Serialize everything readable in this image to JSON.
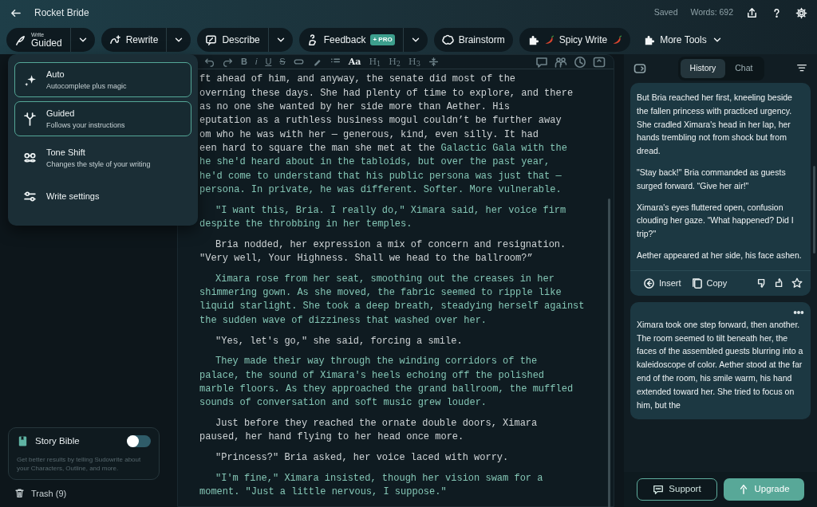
{
  "header": {
    "title": "Rocket Bride",
    "status": "Saved",
    "word_count": "Words: 692"
  },
  "tools": [
    {
      "kind": "write",
      "caption": "Write",
      "label": "Guided",
      "split": true
    },
    {
      "kind": "rewrite",
      "label": "Rewrite",
      "split": true
    },
    {
      "kind": "describe",
      "label": "Describe",
      "split": true
    },
    {
      "kind": "feedback",
      "label": "Feedback",
      "badge": "+ PRO",
      "split": true
    },
    {
      "kind": "brainstorm",
      "label": "Brainstorm",
      "split": false
    },
    {
      "kind": "plugin",
      "label": "Spicy Write",
      "chilis": true,
      "split": false
    },
    {
      "kind": "menu",
      "label": "More Tools"
    }
  ],
  "write_menu": [
    {
      "kind": "auto",
      "title": "Auto",
      "description": "Autocomplete plus magic",
      "outlined": true
    },
    {
      "kind": "guided",
      "title": "Guided",
      "description": "Follows your instructions",
      "outlined": true
    },
    {
      "kind": "tone",
      "title": "Tone Shift",
      "description": "Changes the style of your writing",
      "outlined": false
    },
    {
      "kind": "settings",
      "title": "Write settings",
      "outlined": false
    }
  ],
  "editor_toolbar": [
    {
      "kind": "undo"
    },
    {
      "kind": "redo"
    },
    {
      "kind": "bold",
      "label": "B"
    },
    {
      "kind": "italic",
      "label": "i"
    },
    {
      "kind": "underline",
      "label": "U"
    },
    {
      "kind": "strike",
      "label": "S"
    },
    {
      "kind": "link"
    },
    {
      "kind": "highlight"
    },
    {
      "kind": "list"
    },
    {
      "kind": "font",
      "label": "Aa"
    },
    {
      "kind": "heading",
      "label": "H$_{1}$"
    },
    {
      "kind": "heading",
      "label": "H$_{2}$"
    },
    {
      "kind": "heading",
      "label": "H$_{3}$"
    },
    {
      "kind": "divider"
    }
  ],
  "editor_tools": [
    {
      "kind": "comment"
    },
    {
      "kind": "characters"
    },
    {
      "kind": "history"
    },
    {
      "kind": "screen"
    }
  ],
  "paragraphs": [
    {
      "indent": false,
      "lines": [
        [
          {
            "text": "ft ahead of him, and anyway, the senate did most of the",
            "generated": false
          }
        ],
        [
          {
            "text": "overning these days. She had plenty of time to explore, and there",
            "generated": false
          }
        ],
        [
          {
            "text": "as no one she wanted by her side more than Aether. His",
            "generated": false
          }
        ],
        [
          {
            "text": "eputation as a ruthless business mogul couldn’t be further away",
            "generated": false
          }
        ],
        [
          {
            "text": "om who he was with her — generous, kind, even silly. It had",
            "generated": false
          }
        ],
        [
          {
            "text": "een hard to square the man she met at the ",
            "generated": false
          },
          {
            "text": "Galactic Gala with the",
            "generated": true
          }
        ],
        [
          {
            "text": "he she'd heard about in the tabloids, but over the past year,",
            "generated": true
          }
        ],
        [
          {
            "text": "he'd come to understand that his public persona was just that —",
            "generated": true
          }
        ],
        [
          {
            "text": "persona. In private, he was different. Softer. More vulnerable.",
            "generated": true
          }
        ]
      ]
    },
    {
      "indent": true,
      "lines": [
        [
          {
            "text": "\"I want this, Bria. I really do,\" Ximara said, her voice firm",
            "generated": true
          }
        ],
        [
          {
            "text": "despite the throbbing in her temples.",
            "generated": true
          }
        ]
      ]
    },
    {
      "indent": true,
      "lines": [
        [
          {
            "text": "Bria nodded, her expression a mix of concern and resignation.",
            "generated": false
          }
        ],
        [
          {
            "text": "\"Very well, Your Highness. Shall we head to the ballroom?”",
            "generated": false
          }
        ]
      ]
    },
    {
      "indent": true,
      "lines": [
        [
          {
            "text": "Ximara rose from her seat, smoothing out the creases in her",
            "generated": true
          }
        ],
        [
          {
            "text": "shimmering gown. As she moved, the fabric seemed to ripple like",
            "generated": true
          }
        ],
        [
          {
            "text": "liquid starlight. She took a deep breath, steadying herself against",
            "generated": true
          }
        ],
        [
          {
            "text": "the sudden wave of dizziness that washed over her.",
            "generated": true
          }
        ]
      ]
    },
    {
      "indent": true,
      "lines": [
        [
          {
            "text": "\"Yes, let's go,\" she said, forcing a smile.",
            "generated": false
          }
        ]
      ]
    },
    {
      "indent": true,
      "lines": [
        [
          {
            "text": "They made their way through the winding corridors of the",
            "generated": true
          }
        ],
        [
          {
            "text": "palace, the sound of Ximara's heels echoing off the polished",
            "generated": true
          }
        ],
        [
          {
            "text": "marble floors. As they approached the grand ballroom, the muffled",
            "generated": true
          }
        ],
        [
          {
            "text": "sounds of conversation and soft music grew louder.",
            "generated": true
          }
        ]
      ]
    },
    {
      "indent": true,
      "lines": [
        [
          {
            "text": "Just before they reached the ornate double doors, Ximara",
            "generated": false
          }
        ],
        [
          {
            "text": "paused, her hand flying to her head once more.",
            "generated": false
          }
        ]
      ]
    },
    {
      "indent": true,
      "lines": [
        [
          {
            "text": "\"Princess?\" Bria asked, her voice laced with worry.",
            "generated": false
          }
        ]
      ]
    },
    {
      "indent": true,
      "lines": [
        [
          {
            "text": "\"I'm fine,\" Ximara insisted, though her vision swam for a",
            "generated": true
          }
        ],
        [
          {
            "text": "moment. \"Just a little nervous, I suppose.\"",
            "generated": true
          }
        ]
      ]
    }
  ],
  "story_bible": {
    "title": "Story Bible",
    "on": false,
    "description": "Get better results by telling Sudowrite about your Characters, Outline, and more."
  },
  "trash": {
    "label": "Trash (9)"
  },
  "panel_tabs": [
    {
      "label": "History",
      "selected": true
    },
    {
      "label": "Chat",
      "selected": false
    }
  ],
  "history_cards": [
    {
      "paragraphs": [
        "But Bria reached her first, kneeling beside the fallen princess with practiced urgency. She cradled Ximara's head in her lap, her hands trembling not from shock but from dread.",
        "\"Stay back!\" Bria commanded as guests surged forward. “Give her air!\"",
        "Ximara's eyes fluttered open, confusion clouding her gaze. “What happened? Did I trip?\"",
        "Aether appeared at her side, his face ashen."
      ],
      "actions": [
        "Insert",
        "Copy"
      ],
      "more_menu": false
    },
    {
      "paragraphs": [
        "Ximara took one step forward, then another. The room seemed to tilt beneath her, the faces of the assembled guests blurring into a kaleidoscope of color. Aether stood at the far end of the room, his smile warm, his hand extended toward her. She tried to focus on him, but the"
      ],
      "more_menu": true
    }
  ],
  "footer_buttons": [
    {
      "label": "Support",
      "kind": "support"
    },
    {
      "label": "Upgrade",
      "kind": "upgrade"
    }
  ]
}
